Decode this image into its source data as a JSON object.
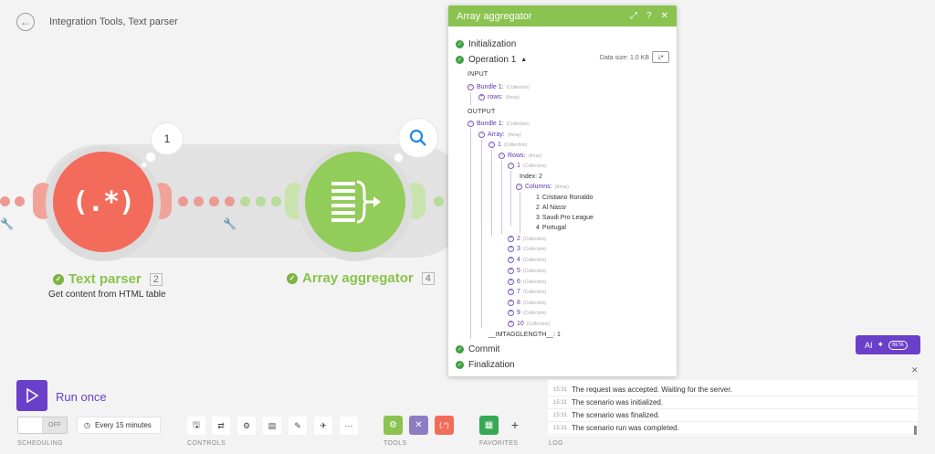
{
  "header": {
    "back_icon": "arrow-left-icon",
    "breadcrumb": "Integration Tools, Text parser"
  },
  "flow": {
    "text_parser": {
      "title": "Text parser",
      "number": "2",
      "subtitle": "Get content from HTML table",
      "glyph": "(.*)",
      "bubble_count": "1",
      "color": "#f26b5b"
    },
    "array_aggregator": {
      "title": "Array aggregator",
      "number": "4",
      "color": "#92cc5a"
    }
  },
  "panel": {
    "title": "Array aggregator",
    "stages": {
      "initialization": "Initialization",
      "operation": "Operation 1",
      "commit": "Commit",
      "finalization": "Finalization"
    },
    "data_size": "Data size: 1.0 KB",
    "input_label": "INPUT",
    "output_label": "OUTPUT",
    "input_tree": {
      "bundle": "Bundle 1:",
      "bundle_type": "(Collection)",
      "rows": "rows:",
      "rows_type": "(Array)"
    },
    "output_tree": {
      "bundle": "Bundle 1:",
      "bundle_type": "(Collection)",
      "array": "Array:",
      "array_type": "(Array)",
      "item1": "1",
      "item1_type": "(Collection)",
      "rows": "Rows:",
      "rows_type": "(Array)",
      "row1": "1",
      "row1_type": "(Collection)",
      "index": "Index: 2",
      "columns": "Columns:",
      "columns_type": "(Array)",
      "column_values": [
        {
          "n": "1",
          "v": "Cristiano Ronaldo"
        },
        {
          "n": "2",
          "v": "Al Nassr"
        },
        {
          "n": "3",
          "v": "Saudi Pro League"
        },
        {
          "n": "4",
          "v": "Portugal"
        }
      ],
      "collections": [
        "2",
        "3",
        "4",
        "5",
        "6",
        "7",
        "8",
        "9",
        "10"
      ],
      "collection_type": "(Collection)",
      "length": "__IMTAGGLENGTH__: 1"
    }
  },
  "ai_button": {
    "label": "AI",
    "badge": "BETA"
  },
  "bottom": {
    "run_label": "Run once",
    "toggle_label": "OFF",
    "schedule": "Every 15 minutes",
    "labels": {
      "scheduling": "SCHEDULING",
      "controls": "CONTROLS",
      "tools": "TOOLS",
      "favorites": "FAVORITES",
      "log": "LOG"
    }
  },
  "log": [
    {
      "time": "15:31",
      "text": "The request was accepted. Waiting for the server."
    },
    {
      "time": "15:31",
      "text": "The scenario was initialized."
    },
    {
      "time": "15:31",
      "text": "The scenario was finalized."
    },
    {
      "time": "15:31",
      "text": "The scenario run was completed."
    }
  ]
}
